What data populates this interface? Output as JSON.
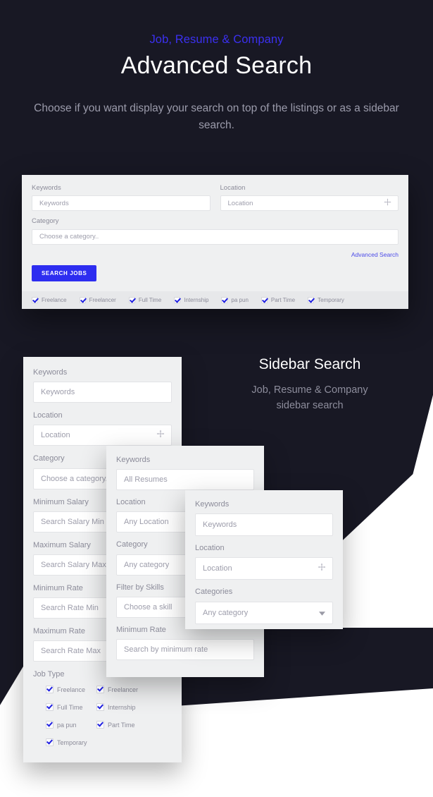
{
  "hero": {
    "eyebrow": "Job, Resume & Company",
    "title": "Advanced Search",
    "subtitle": "Choose if you want display your search on top of the listings or as a sidebar search."
  },
  "side_heading": {
    "title": "Sidebar Search",
    "subtitle_line1": "Job, Resume & Company",
    "subtitle_line2": "sidebar search"
  },
  "colors": {
    "background": "#181824",
    "accent_blue": "#2d2df0",
    "eyebrow_blue": "#3b30f0",
    "link_blue": "#4a49e8",
    "card_bg": "#eff0f1",
    "input_bg": "#ffffff",
    "label_grey": "#8b8b99",
    "placeholder_grey": "#9d9dab"
  },
  "top_panel": {
    "fields": [
      {
        "label": "Keywords",
        "placeholder": "Keywords",
        "icon": ""
      },
      {
        "label": "Location",
        "placeholder": "Location",
        "icon": "locate-icon"
      },
      {
        "label": "Category",
        "placeholder": "Choose a category..",
        "icon": ""
      }
    ],
    "advanced_search_link": "Advanced Search",
    "search_button": "SEARCH JOBS",
    "job_types": [
      "Freelance",
      "Freelancer",
      "Full Time",
      "Internship",
      "pa pun",
      "Part Time",
      "Temporary"
    ]
  },
  "card_job_sidebar": {
    "fields": [
      {
        "label": "Keywords",
        "placeholder": "Keywords",
        "icon": ""
      },
      {
        "label": "Location",
        "placeholder": "Location",
        "icon": "locate-icon"
      },
      {
        "label": "Category",
        "placeholder": "Choose a category..",
        "icon": ""
      },
      {
        "label": "Minimum Salary",
        "placeholder": "Search Salary Min",
        "icon": ""
      },
      {
        "label": "Maximum Salary",
        "placeholder": "Search Salary Max",
        "icon": ""
      },
      {
        "label": "Minimum Rate",
        "placeholder": "Search Rate Min",
        "icon": ""
      },
      {
        "label": "Maximum Rate",
        "placeholder": "Search Rate Max",
        "icon": ""
      }
    ],
    "job_type_title": "Job Type",
    "job_types": [
      "Freelance",
      "Freelancer",
      "Full Time",
      "Internship",
      "pa pun",
      "Part Time",
      "Temporary"
    ]
  },
  "card_resume_sidebar": {
    "fields": [
      {
        "label": "Keywords",
        "placeholder": "All Resumes",
        "icon": ""
      },
      {
        "label": "Location",
        "placeholder": "Any Location",
        "icon": ""
      },
      {
        "label": "Category",
        "placeholder": "Any category",
        "icon": ""
      },
      {
        "label": "Filter by Skills",
        "placeholder": "Choose a skill",
        "icon": ""
      },
      {
        "label": "Minimum Rate",
        "placeholder": "Search by minimum rate",
        "icon": ""
      }
    ]
  },
  "card_company_sidebar": {
    "fields": [
      {
        "label": "Keywords",
        "placeholder": "Keywords",
        "icon": ""
      },
      {
        "label": "Location",
        "placeholder": "Location",
        "icon": "locate-icon"
      },
      {
        "label": "Categories",
        "placeholder": "Any category",
        "icon": "caret-down-icon"
      }
    ]
  }
}
